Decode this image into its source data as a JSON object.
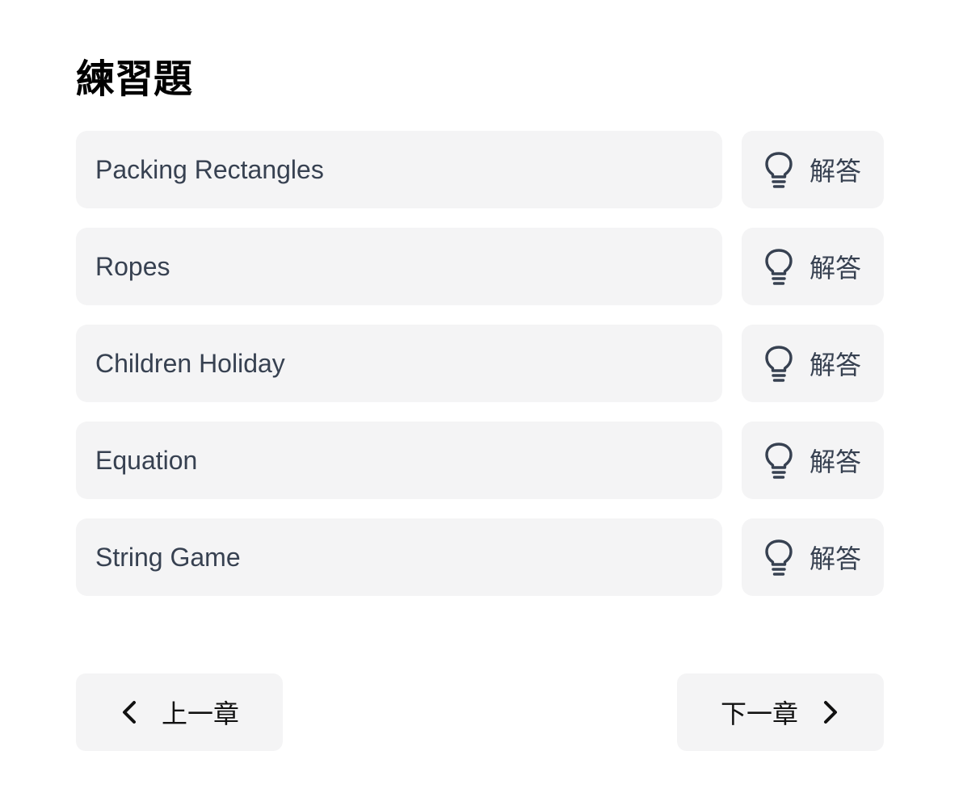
{
  "page": {
    "title": "練習題"
  },
  "exercises": [
    {
      "title": "Packing Rectangles",
      "solution_label": "解答",
      "solution_icon": "lightbulb-icon"
    },
    {
      "title": "Ropes",
      "solution_label": "解答",
      "solution_icon": "lightbulb-icon"
    },
    {
      "title": "Children Holiday",
      "solution_label": "解答",
      "solution_icon": "lightbulb-icon"
    },
    {
      "title": "Equation",
      "solution_label": "解答",
      "solution_icon": "lightbulb-icon"
    },
    {
      "title": "String Game",
      "solution_label": "解答",
      "solution_icon": "lightbulb-icon"
    }
  ],
  "navigation": {
    "prev_label": "上一章",
    "prev_icon": "chevron-left-icon",
    "next_label": "下一章",
    "next_icon": "chevron-right-icon"
  },
  "colors": {
    "card_background": "#f4f4f5",
    "text": "#374151",
    "title": "#000000"
  }
}
